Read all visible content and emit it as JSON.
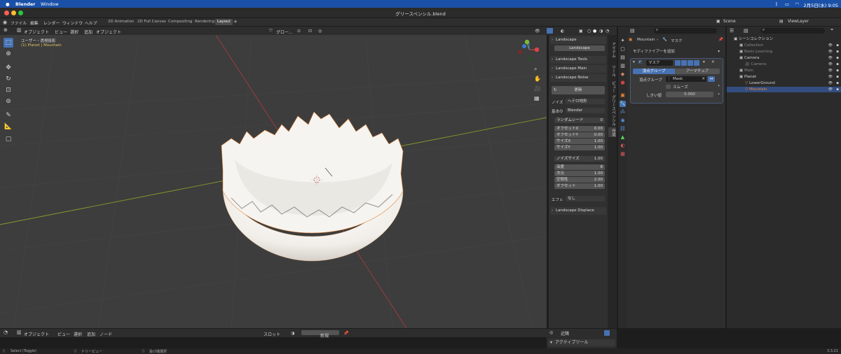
{
  "mac_menu": {
    "app": "Blender",
    "window": "Window",
    "time": "2月5日(水) 9:05"
  },
  "window_title": "グリースペンシル.blend",
  "menu": [
    "ファイル",
    "編集",
    "レンダー",
    "ウィンドウ",
    "ヘルプ"
  ],
  "workspaces": [
    {
      "label": "2D Animation",
      "active": false
    },
    {
      "label": "2D Full Canvas",
      "active": false
    },
    {
      "label": "Compositing",
      "active": false
    },
    {
      "label": "Rendering",
      "active": false
    },
    {
      "label": "Layout",
      "active": true
    }
  ],
  "scene": {
    "label": "Scene",
    "viewlayer": "ViewLayer"
  },
  "viewport_header": {
    "mode": "オブジェクト",
    "menus": [
      "ビュー",
      "選択",
      "追加",
      "オブジェクト"
    ],
    "orientation": "グロー..."
  },
  "viewport_overlay": {
    "line1": "ユーザー・透視投影",
    "line2": "(1) Planet | Mountain"
  },
  "gizmo": {
    "x": "X",
    "y": "Y",
    "z": "Z"
  },
  "npanel": {
    "landscape_header": "Landscape",
    "landscape_btn": "Landscape",
    "tools": "Landscape Tools",
    "main": "Landscape Main",
    "noise": "Landscape Noise",
    "update": "更新",
    "noise_label": "ノイズ",
    "noise_value": "ヘテロ地形",
    "basis_label": "基本の",
    "basis_value": "Blender",
    "random_seed": "ランダムシード",
    "random_seed_value": "0",
    "fields1": [
      {
        "k": "オフセットX",
        "v": "0.00"
      },
      {
        "k": "オフセットY",
        "v": "0.00"
      },
      {
        "k": "サイズX",
        "v": "1.00"
      },
      {
        "k": "サイズY",
        "v": "1.00"
      }
    ],
    "noise_size": "ノイズサイズ",
    "noise_size_value": "1.00",
    "fields2": [
      {
        "k": "深度",
        "v": "8"
      },
      {
        "k": "次元",
        "v": "1.00"
      },
      {
        "k": "空隙性",
        "v": "2.00"
      },
      {
        "k": "オフセット",
        "v": "1.00"
      }
    ],
    "effect_label": "エフェ",
    "effect_value": "なし",
    "displace": "Landscape Displace"
  },
  "vtabs": [
    "アイテム",
    "ツール",
    "ビュー",
    "グリースペンシル",
    "作成"
  ],
  "properties": {
    "breadcrumb_obj": "Mountain",
    "breadcrumb_mod": "マスク",
    "add_modifier": "モディファイアーを追加",
    "modifier_name": "マスク",
    "tab_vgroup": "頂点グループ",
    "tab_armature": "アーマチュア",
    "vgroup_label": "頂点グループ",
    "vgroup_value": "Mask",
    "smooth_label": "スムーズ",
    "threshold_label": "しきい値",
    "threshold_value": "0.000"
  },
  "outliner": {
    "root": "シーンコレクション",
    "items": [
      {
        "label": "Collection",
        "indent": 1,
        "dim": true
      },
      {
        "label": "Basic;Learning",
        "indent": 1,
        "dim": true
      },
      {
        "label": "Camera",
        "indent": 1,
        "dim": false
      },
      {
        "label": "Camera",
        "indent": 2,
        "dim": true
      },
      {
        "label": "Main",
        "indent": 1,
        "dim": true
      },
      {
        "label": "Planet",
        "indent": 1,
        "dim": false
      },
      {
        "label": "LowerGround",
        "indent": 2,
        "dim": false
      },
      {
        "label": "Mountain",
        "indent": 2,
        "dim": false,
        "selected": true
      }
    ]
  },
  "bottom_editor": {
    "mode": "オブジェクト",
    "menus": [
      "ビュー",
      "選択",
      "追加",
      "ノード"
    ],
    "slot": "スロット",
    "new": "新規",
    "near": "近隣",
    "active_tool": "アクティブツール"
  },
  "status": {
    "select": "Select (Toggle)",
    "drag": "ドリーピュー",
    "lasso": "投げ縄選択",
    "version": "3.3.21"
  },
  "colors": {
    "accent": "#4772b3",
    "selected_row": "#334d80",
    "orange": "#e8873a"
  }
}
